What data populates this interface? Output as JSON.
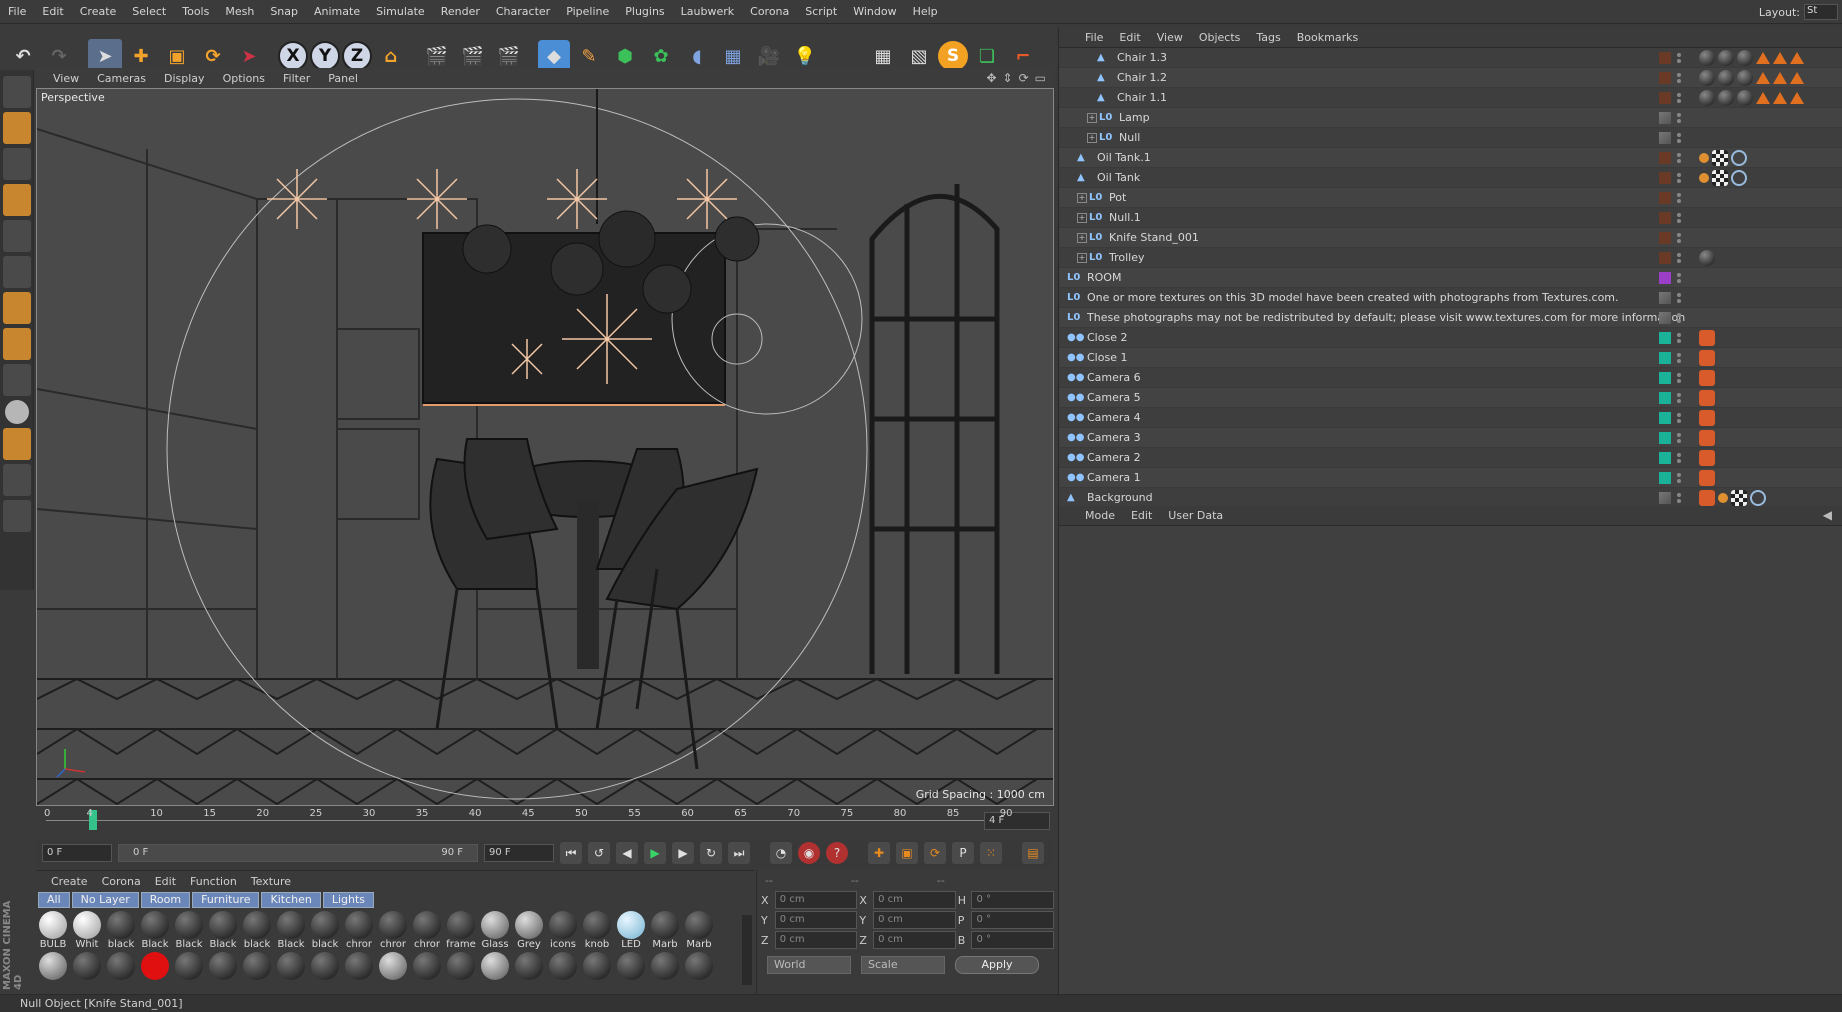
{
  "menubar": {
    "items": [
      "File",
      "Edit",
      "Create",
      "Select",
      "Tools",
      "Mesh",
      "Snap",
      "Animate",
      "Simulate",
      "Render",
      "Character",
      "Pipeline",
      "Plugins",
      "Laubwerk",
      "Corona",
      "Script",
      "Window",
      "Help"
    ],
    "layout_label": "Layout:",
    "layout_value": "St"
  },
  "toolbar": {
    "axis_x": "X",
    "axis_y": "Y",
    "axis_z": "Z",
    "s_label": "S"
  },
  "viewport": {
    "menu": [
      "View",
      "Cameras",
      "Display",
      "Options",
      "Filter",
      "Panel"
    ],
    "label": "Perspective",
    "grid_spacing": "Grid Spacing : 1000 cm"
  },
  "timeline": {
    "ticks": [
      "0",
      "4",
      "10",
      "15",
      "20",
      "25",
      "30",
      "35",
      "40",
      "45",
      "50",
      "55",
      "60",
      "65",
      "70",
      "75",
      "80",
      "85",
      "90"
    ],
    "current_frame": "4 F"
  },
  "transport": {
    "start": "0 F",
    "range_start": "0 F",
    "range_end": "90 F",
    "end": "90 F"
  },
  "materials": {
    "menu": [
      "Create",
      "Corona",
      "Edit",
      "Function",
      "Texture"
    ],
    "tabs": [
      "All",
      "No Layer",
      "Room",
      "Furniture",
      "Kitchen",
      "Lights"
    ],
    "row1": [
      "BULB",
      "Whit",
      "black",
      "Black",
      "Black",
      "Black",
      "black",
      "Black",
      "black",
      "chror",
      "chror",
      "chror",
      "frame",
      "Glass",
      "Grey",
      "icons",
      "knob",
      "LED",
      "Marb",
      "Marb"
    ]
  },
  "coords": {
    "head": [
      "--",
      "--",
      "--"
    ],
    "rows": [
      {
        "a": "X",
        "v1": "0 cm",
        "b": "X",
        "v2": "0 cm",
        "c": "H",
        "v3": "0 °"
      },
      {
        "a": "Y",
        "v1": "0 cm",
        "b": "Y",
        "v2": "0 cm",
        "c": "P",
        "v3": "0 °"
      },
      {
        "a": "Z",
        "v1": "0 cm",
        "b": "Z",
        "v2": "0 cm",
        "c": "B",
        "v3": "0 °"
      }
    ],
    "mode1": "World",
    "mode2": "Scale",
    "apply": "Apply"
  },
  "object_manager": {
    "menu": [
      "File",
      "Edit",
      "View",
      "Objects",
      "Tags",
      "Bookmarks"
    ],
    "rows": [
      {
        "name": "Chair 1.3",
        "indent": 3,
        "type": "tri"
      },
      {
        "name": "Chair 1.2",
        "indent": 3,
        "type": "tri"
      },
      {
        "name": "Chair 1.1",
        "indent": 3,
        "type": "tri"
      },
      {
        "name": "Lamp",
        "indent": 2,
        "type": "null"
      },
      {
        "name": "Null",
        "indent": 2,
        "type": "null"
      },
      {
        "name": "Oil Tank.1",
        "indent": 1,
        "type": "tri"
      },
      {
        "name": "Oil Tank",
        "indent": 1,
        "type": "tri"
      },
      {
        "name": "Pot",
        "indent": 1,
        "type": "null"
      },
      {
        "name": "Null.1",
        "indent": 1,
        "type": "null"
      },
      {
        "name": "Knife Stand_001",
        "indent": 1,
        "type": "null"
      },
      {
        "name": "Trolley",
        "indent": 1,
        "type": "null"
      },
      {
        "name": "ROOM",
        "indent": 0,
        "type": "null"
      },
      {
        "name": "One or more textures on this 3D model have been created with photographs from Textures.com.",
        "indent": 0,
        "type": "null"
      },
      {
        "name": "These photographs may not be redistributed by default; please visit www.textures.com for more information",
        "indent": 0,
        "type": "null"
      },
      {
        "name": "Close 2",
        "indent": 0,
        "type": "cam"
      },
      {
        "name": "Close 1",
        "indent": 0,
        "type": "cam"
      },
      {
        "name": "Camera 6",
        "indent": 0,
        "type": "cam"
      },
      {
        "name": "Camera 5",
        "indent": 0,
        "type": "cam"
      },
      {
        "name": "Camera 4",
        "indent": 0,
        "type": "cam"
      },
      {
        "name": "Camera 3",
        "indent": 0,
        "type": "cam"
      },
      {
        "name": "Camera 2",
        "indent": 0,
        "type": "cam"
      },
      {
        "name": "Camera 1",
        "indent": 0,
        "type": "cam"
      },
      {
        "name": "Background",
        "indent": 0,
        "type": "tri"
      }
    ]
  },
  "attributes": {
    "menu": [
      "Mode",
      "Edit",
      "User Data"
    ]
  },
  "status": {
    "text": "Null Object [Knife Stand_001]"
  },
  "brand": "MAXON CINEMA 4D"
}
